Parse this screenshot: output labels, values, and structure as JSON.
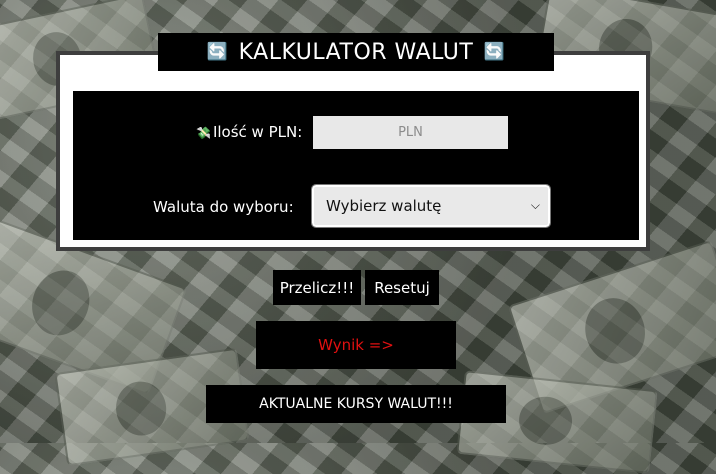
{
  "header": {
    "title": "KALKULATOR WALUT",
    "left_icon": "swap-icon",
    "right_icon": "swap-icon"
  },
  "form": {
    "amount_label": "Ilość w PLN:",
    "amount_icon": "money-icon",
    "amount_placeholder": "PLN",
    "amount_value": "",
    "currency_label": "Waluta do wyboru:",
    "currency_selected": "Wybierz walutę"
  },
  "actions": {
    "convert_label": "Przelicz!!!",
    "reset_label": "Resetuj"
  },
  "result": {
    "label": "Wynik =>"
  },
  "rates_button": {
    "label": "AKTUALNE KURSY WALUT!!!"
  },
  "colors": {
    "result_text": "#e01010",
    "panel_bg": "#000000"
  }
}
